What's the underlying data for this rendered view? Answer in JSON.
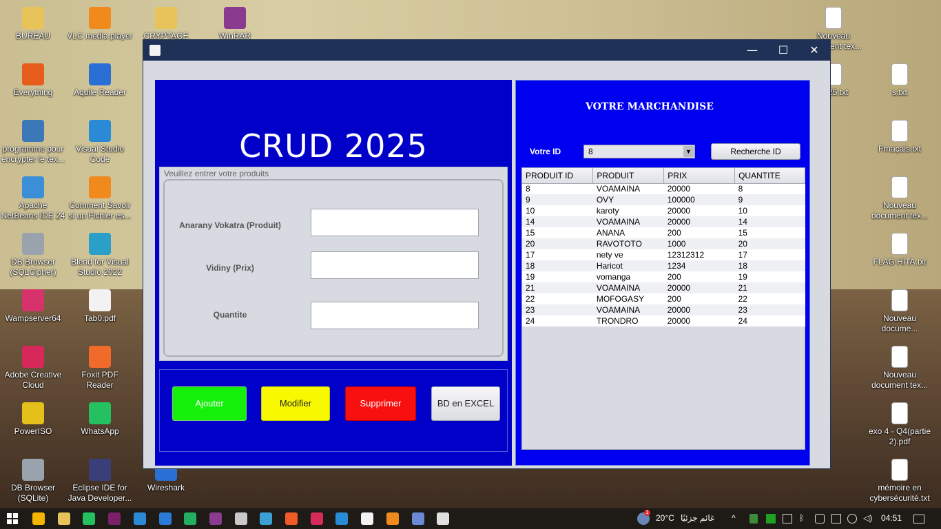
{
  "desktop": {
    "left_icons": [
      {
        "label": "BUREAU",
        "color": "#e7c35a"
      },
      {
        "label": "VLC media player",
        "color": "#f08a1c"
      },
      {
        "label": "CRYPTAGE",
        "color": "#e7c35a"
      },
      {
        "label": "WinRAR",
        "color": "#8a3b8f"
      },
      {
        "label": "Everything",
        "color": "#e65c1a"
      },
      {
        "label": "Aquile Reader",
        "color": "#2a6fd6"
      },
      {
        "label": "programme pour encrypter le tex...",
        "color": "#3c78b8"
      },
      {
        "label": "Visual Studio Code",
        "color": "#2a8ad6"
      },
      {
        "label": "Apache NetBeans IDE 24",
        "color": "#3a8fd6"
      },
      {
        "label": "Comment Savoir si un Fichier es...",
        "color": "#f08a1c"
      },
      {
        "label": "DB Browser (SQLCipher)",
        "color": "#9aa3ad"
      },
      {
        "label": "Blend for Visual Studio 2022",
        "color": "#2aa0c8"
      },
      {
        "label": "Wampserver64",
        "color": "#d6336c"
      },
      {
        "label": "Tab0.pdf",
        "color": "#f2f2f2"
      },
      {
        "label": "Adobe Creative Cloud",
        "color": "#d6285a"
      },
      {
        "label": "Foxit PDF Reader",
        "color": "#f06a2a"
      },
      {
        "label": "PowerISO",
        "color": "#e6c01a"
      },
      {
        "label": "WhatsApp",
        "color": "#25c060"
      },
      {
        "label": "DB Browser (SQLite)",
        "color": "#9aa3ad"
      },
      {
        "label": "Eclipse IDE for Java Developer...",
        "color": "#3a3f7a"
      },
      {
        "label": "Wireshark",
        "color": "#2a6fd6"
      }
    ],
    "right_icons": [
      {
        "label": "Nouveau document tex..."
      },
      {
        "label": "2025.txt"
      },
      {
        "label": "s.txt"
      },
      {
        "label": "Frnaçais.txt"
      },
      {
        "label": "Nouveau document tex..."
      },
      {
        "label": "FLAG HITA.txt"
      },
      {
        "label": "Nouveau docume..."
      },
      {
        "label": "Nouveau document tex..."
      },
      {
        "label": "exo 4 - Q4(partie 2).pdf"
      },
      {
        "label": "mémoire en cybersécurité.txt"
      }
    ]
  },
  "window": {
    "controls": {
      "minimize": "—",
      "maximize": "☐",
      "close": "✕"
    }
  },
  "left_panel": {
    "title": "CRUD 2025",
    "form_legend": "Veuillez entrer votre produits",
    "fields": [
      {
        "label": "Anarany Vokatra (Produit)",
        "value": ""
      },
      {
        "label": "Vidiny (Prix)",
        "value": ""
      },
      {
        "label": "Quantite",
        "value": ""
      }
    ],
    "buttons": [
      {
        "label": "Ajouter",
        "color": "#14f00a"
      },
      {
        "label": "Modifier",
        "color": "#f8f800"
      },
      {
        "label": "Supprimer",
        "color": "#f81010"
      },
      {
        "label": "BD en EXCEL",
        "color": "#e8e9ee"
      }
    ]
  },
  "right_panel": {
    "title": "VOTRE MARCHANDISE",
    "id_label": "Votre ID",
    "id_selected": "8",
    "search_label": "Recherche ID",
    "table": {
      "headers": [
        "PRODUIT ID",
        "PRODUIT",
        "PRIX",
        "QUANTITE"
      ],
      "rows": [
        [
          "8",
          "VOAMAINA",
          "20000",
          "8"
        ],
        [
          "9",
          "OVY",
          "100000",
          "9"
        ],
        [
          "10",
          "karoty",
          "20000",
          "10"
        ],
        [
          "14",
          "VOAMAINA",
          "20000",
          "14"
        ],
        [
          "15",
          "ANANA",
          "200",
          "15"
        ],
        [
          "20",
          "RAVOTOTO",
          "1000",
          "20"
        ],
        [
          "17",
          "nety ve",
          "12312312",
          "17"
        ],
        [
          "18",
          "Haricot",
          "1234",
          "18"
        ],
        [
          "19",
          "vomanga",
          "200",
          "19"
        ],
        [
          "21",
          "VOAMAINA",
          "20000",
          "21"
        ],
        [
          "22",
          "MOFOGASY",
          "200",
          "22"
        ],
        [
          "23",
          "VOAMAINA",
          "20000",
          "23"
        ],
        [
          "24",
          "TRONDRO",
          "20000",
          "24"
        ]
      ]
    }
  },
  "taskbar": {
    "weather": "20°C",
    "weather_desc": "غائم جزئيًا",
    "time": "04:51",
    "notification_count": "1"
  }
}
